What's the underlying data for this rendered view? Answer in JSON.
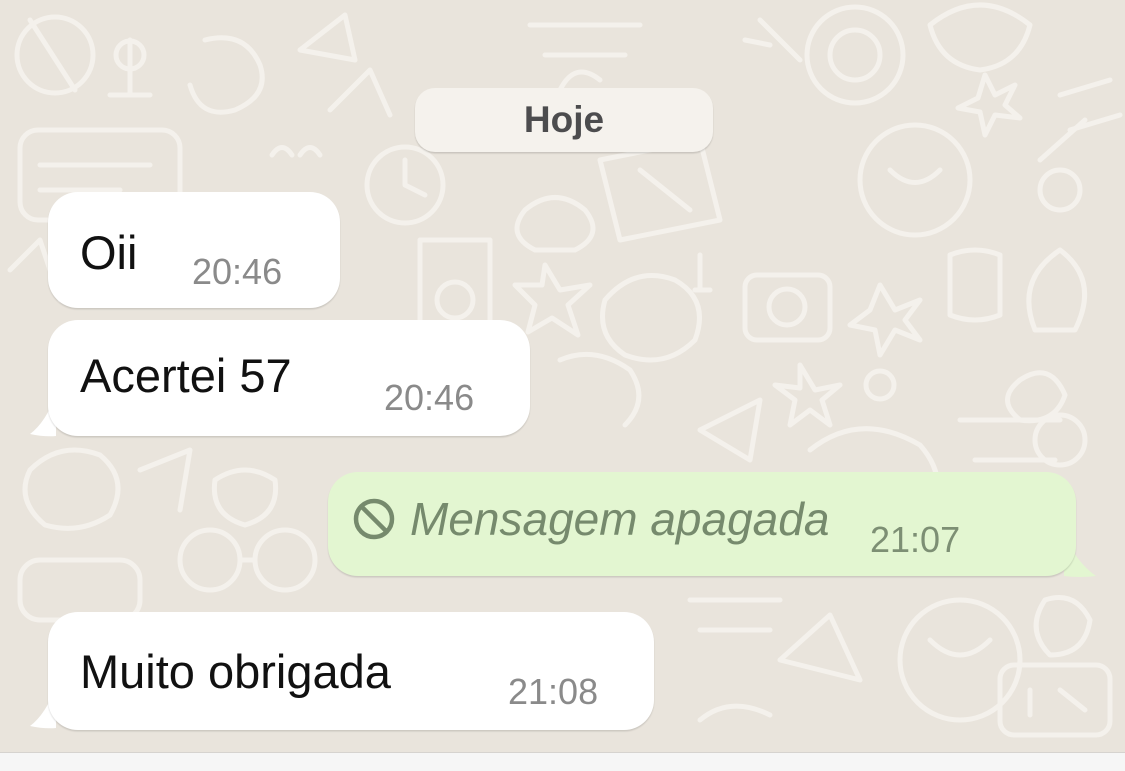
{
  "date_separator": "Hoje",
  "messages": [
    {
      "direction": "incoming",
      "text": "Oii",
      "time": "20:46"
    },
    {
      "direction": "incoming",
      "text": "Acertei 57",
      "time": "20:46"
    },
    {
      "direction": "outgoing",
      "text": "Mensagem apagada",
      "time": "21:07",
      "deleted": true,
      "icon": "blocked-icon"
    },
    {
      "direction": "incoming",
      "text": "Muito obrigada",
      "time": "21:08"
    }
  ],
  "colors": {
    "background": "#e9e4dc",
    "incoming_bubble": "#ffffff",
    "outgoing_bubble": "#e3f6d1",
    "timestamp": "#8a8a8a",
    "deleted_text": "#768a6d"
  }
}
